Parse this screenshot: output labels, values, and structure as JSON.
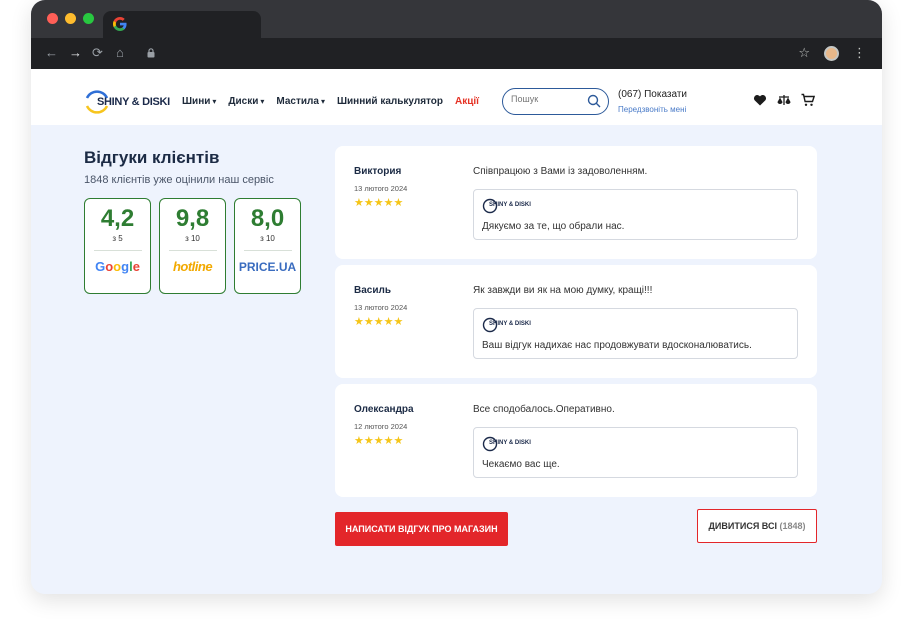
{
  "header": {
    "logo_text": "SHINY & DISKI",
    "menu": [
      {
        "label": "Шини",
        "dropdown": true
      },
      {
        "label": "Диски",
        "dropdown": true
      },
      {
        "label": "Мастила",
        "dropdown": true
      },
      {
        "label": "Шинний калькулятор",
        "dropdown": false
      },
      {
        "label": "Акції",
        "dropdown": false
      }
    ],
    "search_placeholder": "Пошук",
    "phone": "(067) Показати",
    "callback": "Передзвоніть мені",
    "icons": [
      "heart-icon",
      "compare-icon",
      "cart-icon"
    ]
  },
  "rating": {
    "title": "Відгуки клієнтів",
    "subtitle": "1848 клієнтів уже оцінили наш сервіс",
    "scores": [
      {
        "value": "4,2",
        "of": "з 5",
        "brand": "Google"
      },
      {
        "value": "9,8",
        "of": "з 10",
        "brand": "hotline"
      },
      {
        "value": "8,0",
        "of": "з 10",
        "brand": "PRICE.UA"
      }
    ]
  },
  "reviews": [
    {
      "name": "Виктория",
      "date": "13 лютого 2024",
      "stars": 5,
      "text": "Співпрацюю з Вами із задоволенням.",
      "reply_logo": "SHINY & DISKI",
      "reply": "Дякуємо за те, що обрали нас."
    },
    {
      "name": "Василь",
      "date": "13 лютого 2024",
      "stars": 5,
      "text": "Як завжди ви як на мою думку, кращі!!!",
      "reply_logo": "SHINY & DISKI",
      "reply": "Ваш відгук надихає нас продовжувати вдосконалюватись."
    },
    {
      "name": "Олександра",
      "date": "12 лютого 2024",
      "stars": 5,
      "text": "Все сподобалось.Оперативно.",
      "reply_logo": "SHINY & DISKI",
      "reply": "Чекаємо вас ще."
    }
  ],
  "actions": {
    "write_review": "НАПИСАТИ ВІДГУК ПРО МАГАЗИН",
    "view_all": "ДИВИТИСЯ ВСІ",
    "view_all_count": "(1848)"
  },
  "colors": {
    "accent_red": "#e3262a",
    "score_green": "#2e7d32",
    "star": "#f5c518",
    "page_bg": "#eef3fd"
  }
}
